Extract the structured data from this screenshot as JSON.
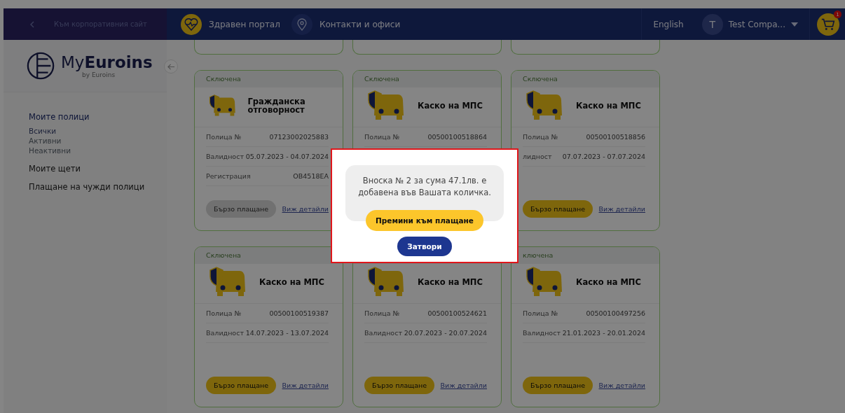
{
  "navbar": {
    "back_link": "Към корпоративния сайт",
    "links": [
      {
        "label": "Здравен портал"
      },
      {
        "label": "Контакти и офиси"
      }
    ],
    "language": "English",
    "avatar": "T",
    "user": "Test Compa...",
    "cart_count": "1"
  },
  "sidebar": {
    "logo_main": "My",
    "logo_bold": "Euroins",
    "logo_sub": "by Euroins",
    "sections": [
      {
        "label": "Моите полици",
        "kind": "group",
        "children": [
          {
            "label": "Всички",
            "selected": true
          },
          {
            "label": "Активни",
            "selected": false
          },
          {
            "label": "Неактивни",
            "selected": false
          }
        ]
      },
      {
        "label": "Моите щети",
        "kind": "link"
      },
      {
        "label": "Плащане на чужди полици",
        "kind": "link"
      }
    ]
  },
  "policies": [
    {
      "status": "Сключена",
      "title": "Гражданска отговорност",
      "fields": [
        {
          "label": "Полица №",
          "value": "07123002025883"
        },
        {
          "label": "Валидност",
          "value": "05.07.2023 - 04.07.2024"
        },
        {
          "label": "Регистрация",
          "value": "OB4518EA"
        }
      ],
      "pay": "Бързо плащане",
      "pay_disabled": true,
      "details": "Виж детайли"
    },
    {
      "status": "Сключена",
      "title": "Каско на МПС",
      "fields": [
        {
          "label": "Полица №",
          "value": "00500100518864"
        }
      ]
    },
    {
      "status": "Сключена",
      "title": "Каско на МПС",
      "fields": [
        {
          "label": "Полица №",
          "value": "00500100518856"
        },
        {
          "label": "лидност",
          "value": "07.07.2023 - 07.07.2024"
        }
      ],
      "pay": "Бързо плащане",
      "pay_disabled": false,
      "details": "Виж детайли"
    },
    {
      "status": "Сключена",
      "title": "Каско на МПС",
      "fields": [
        {
          "label": "Полица №",
          "value": "00500100519387"
        },
        {
          "label": "Валидност",
          "value": "14.07.2023 - 13.07.2024"
        }
      ],
      "pay": "Бързо плащане",
      "pay_disabled": false,
      "details": "Виж детайли"
    },
    {
      "title": "Каско на МПС",
      "fields": [
        {
          "label": "Полица №",
          "value": "00500100524621"
        },
        {
          "label": "Валидност",
          "value": "20.07.2023 - 20.07.2024"
        }
      ],
      "pay": "Бързо плащане",
      "pay_disabled": false,
      "details": "Виж детайли"
    },
    {
      "status": "ключена",
      "title": "Каско на МПС",
      "fields": [
        {
          "label": "Полица №",
          "value": "00500100497256"
        },
        {
          "label": "Валидност",
          "value": "21.01.2023 - 20.01.2024"
        }
      ],
      "pay": "Бързо плащане",
      "pay_disabled": false,
      "details": "Виж детайли"
    }
  ],
  "modal": {
    "message": "Вноска № 2 за сума 47.1лв. е добавена във Вашата количка.",
    "primary": "Премини към плащане",
    "secondary": "Затвори"
  }
}
